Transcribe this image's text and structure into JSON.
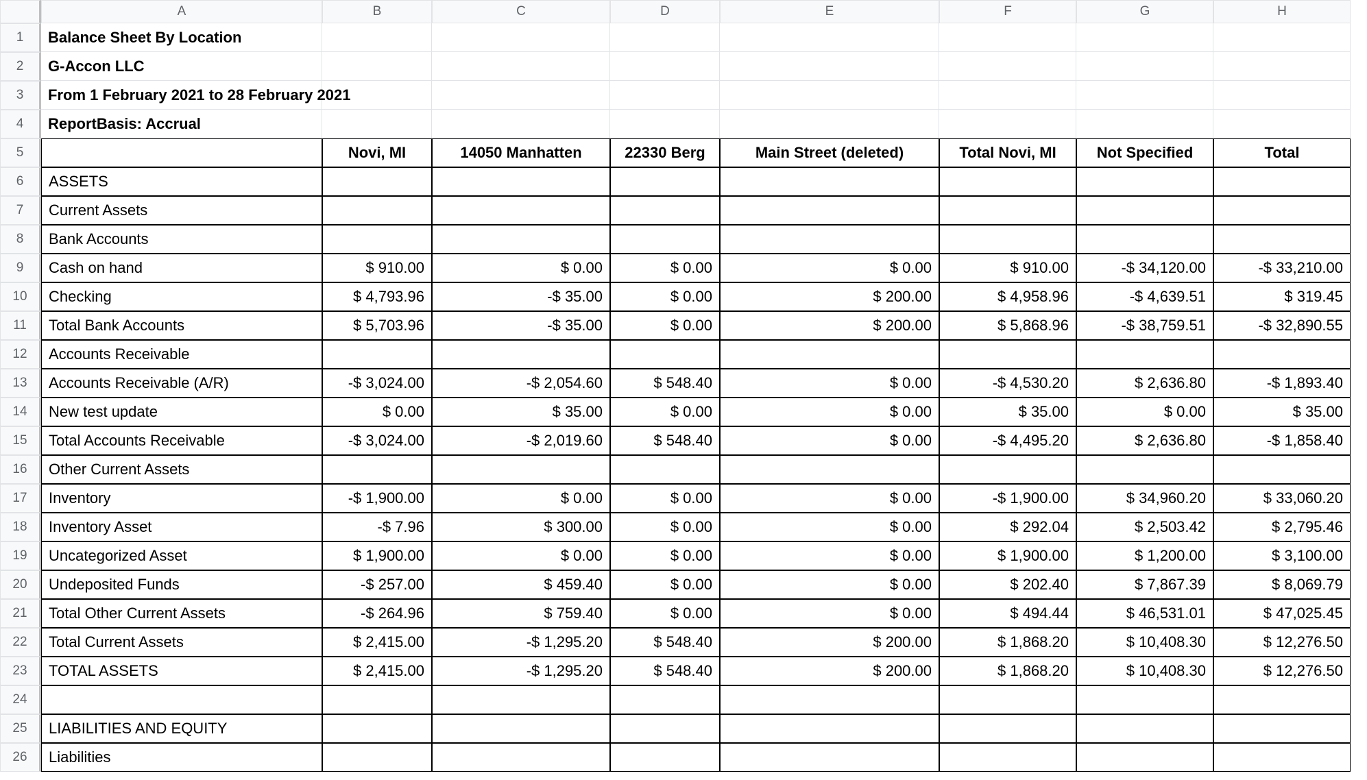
{
  "columns": [
    "A",
    "B",
    "C",
    "D",
    "E",
    "F",
    "G",
    "H"
  ],
  "rowCount": 26,
  "title": "Balance Sheet By Location",
  "company": "G-Accon LLC",
  "period": "From 1 February 2021 to 28 February 2021",
  "basis": "ReportBasis: Accrual",
  "headers": {
    "b": "Novi, MI",
    "c": "14050 Manhatten",
    "d": "22330 Berg",
    "e": "Main Street (deleted)",
    "f": "Total Novi, MI",
    "g": "Not Specified",
    "h": "Total"
  },
  "rows": [
    {
      "n": 6,
      "a": "ASSETS",
      "vals": [
        "",
        "",
        "",
        "",
        "",
        "",
        ""
      ]
    },
    {
      "n": 7,
      "a": "Current Assets",
      "vals": [
        "",
        "",
        "",
        "",
        "",
        "",
        ""
      ]
    },
    {
      "n": 8,
      "a": "Bank Accounts",
      "vals": [
        "",
        "",
        "",
        "",
        "",
        "",
        ""
      ]
    },
    {
      "n": 9,
      "a": "Cash on hand",
      "vals": [
        "$ 910.00",
        "$ 0.00",
        "$ 0.00",
        "$ 0.00",
        "$ 910.00",
        "-$ 34,120.00",
        "-$ 33,210.00"
      ]
    },
    {
      "n": 10,
      "a": "Checking",
      "vals": [
        "$ 4,793.96",
        "-$ 35.00",
        "$ 0.00",
        "$ 200.00",
        "$ 4,958.96",
        "-$ 4,639.51",
        "$ 319.45"
      ]
    },
    {
      "n": 11,
      "a": "Total Bank Accounts",
      "vals": [
        "$ 5,703.96",
        "-$ 35.00",
        "$ 0.00",
        "$ 200.00",
        "$ 5,868.96",
        "-$ 38,759.51",
        "-$ 32,890.55"
      ]
    },
    {
      "n": 12,
      "a": "Accounts Receivable",
      "vals": [
        "",
        "",
        "",
        "",
        "",
        "",
        ""
      ]
    },
    {
      "n": 13,
      "a": "Accounts Receivable (A/R)",
      "vals": [
        "-$ 3,024.00",
        "-$ 2,054.60",
        "$ 548.40",
        "$ 0.00",
        "-$ 4,530.20",
        "$ 2,636.80",
        "-$ 1,893.40"
      ]
    },
    {
      "n": 14,
      "a": "New test update",
      "vals": [
        "$ 0.00",
        "$ 35.00",
        "$ 0.00",
        "$ 0.00",
        "$ 35.00",
        "$ 0.00",
        "$ 35.00"
      ]
    },
    {
      "n": 15,
      "a": "Total Accounts Receivable",
      "vals": [
        "-$ 3,024.00",
        "-$ 2,019.60",
        "$ 548.40",
        "$ 0.00",
        "-$ 4,495.20",
        "$ 2,636.80",
        "-$ 1,858.40"
      ]
    },
    {
      "n": 16,
      "a": "Other Current Assets",
      "vals": [
        "",
        "",
        "",
        "",
        "",
        "",
        ""
      ]
    },
    {
      "n": 17,
      "a": "Inventory",
      "vals": [
        "-$ 1,900.00",
        "$ 0.00",
        "$ 0.00",
        "$ 0.00",
        "-$ 1,900.00",
        "$ 34,960.20",
        "$ 33,060.20"
      ]
    },
    {
      "n": 18,
      "a": "Inventory Asset",
      "vals": [
        "-$ 7.96",
        "$ 300.00",
        "$ 0.00",
        "$ 0.00",
        "$ 292.04",
        "$ 2,503.42",
        "$ 2,795.46"
      ]
    },
    {
      "n": 19,
      "a": "Uncategorized Asset",
      "vals": [
        "$ 1,900.00",
        "$ 0.00",
        "$ 0.00",
        "$ 0.00",
        "$ 1,900.00",
        "$ 1,200.00",
        "$ 3,100.00"
      ]
    },
    {
      "n": 20,
      "a": "Undeposited Funds",
      "vals": [
        "-$ 257.00",
        "$ 459.40",
        "$ 0.00",
        "$ 0.00",
        "$ 202.40",
        "$ 7,867.39",
        "$ 8,069.79"
      ]
    },
    {
      "n": 21,
      "a": "Total Other Current Assets",
      "vals": [
        "-$ 264.96",
        "$ 759.40",
        "$ 0.00",
        "$ 0.00",
        "$ 494.44",
        "$ 46,531.01",
        "$ 47,025.45"
      ]
    },
    {
      "n": 22,
      "a": "Total Current Assets",
      "vals": [
        "$ 2,415.00",
        "-$ 1,295.20",
        "$ 548.40",
        "$ 200.00",
        "$ 1,868.20",
        "$ 10,408.30",
        "$ 12,276.50"
      ]
    },
    {
      "n": 23,
      "a": "TOTAL ASSETS",
      "vals": [
        "$ 2,415.00",
        "-$ 1,295.20",
        "$ 548.40",
        "$ 200.00",
        "$ 1,868.20",
        "$ 10,408.30",
        "$ 12,276.50"
      ]
    },
    {
      "n": 24,
      "a": "",
      "vals": [
        "",
        "",
        "",
        "",
        "",
        "",
        ""
      ]
    },
    {
      "n": 25,
      "a": "LIABILITIES AND EQUITY",
      "vals": [
        "",
        "",
        "",
        "",
        "",
        "",
        ""
      ]
    },
    {
      "n": 26,
      "a": "Liabilities",
      "vals": [
        "",
        "",
        "",
        "",
        "",
        "",
        ""
      ]
    }
  ]
}
